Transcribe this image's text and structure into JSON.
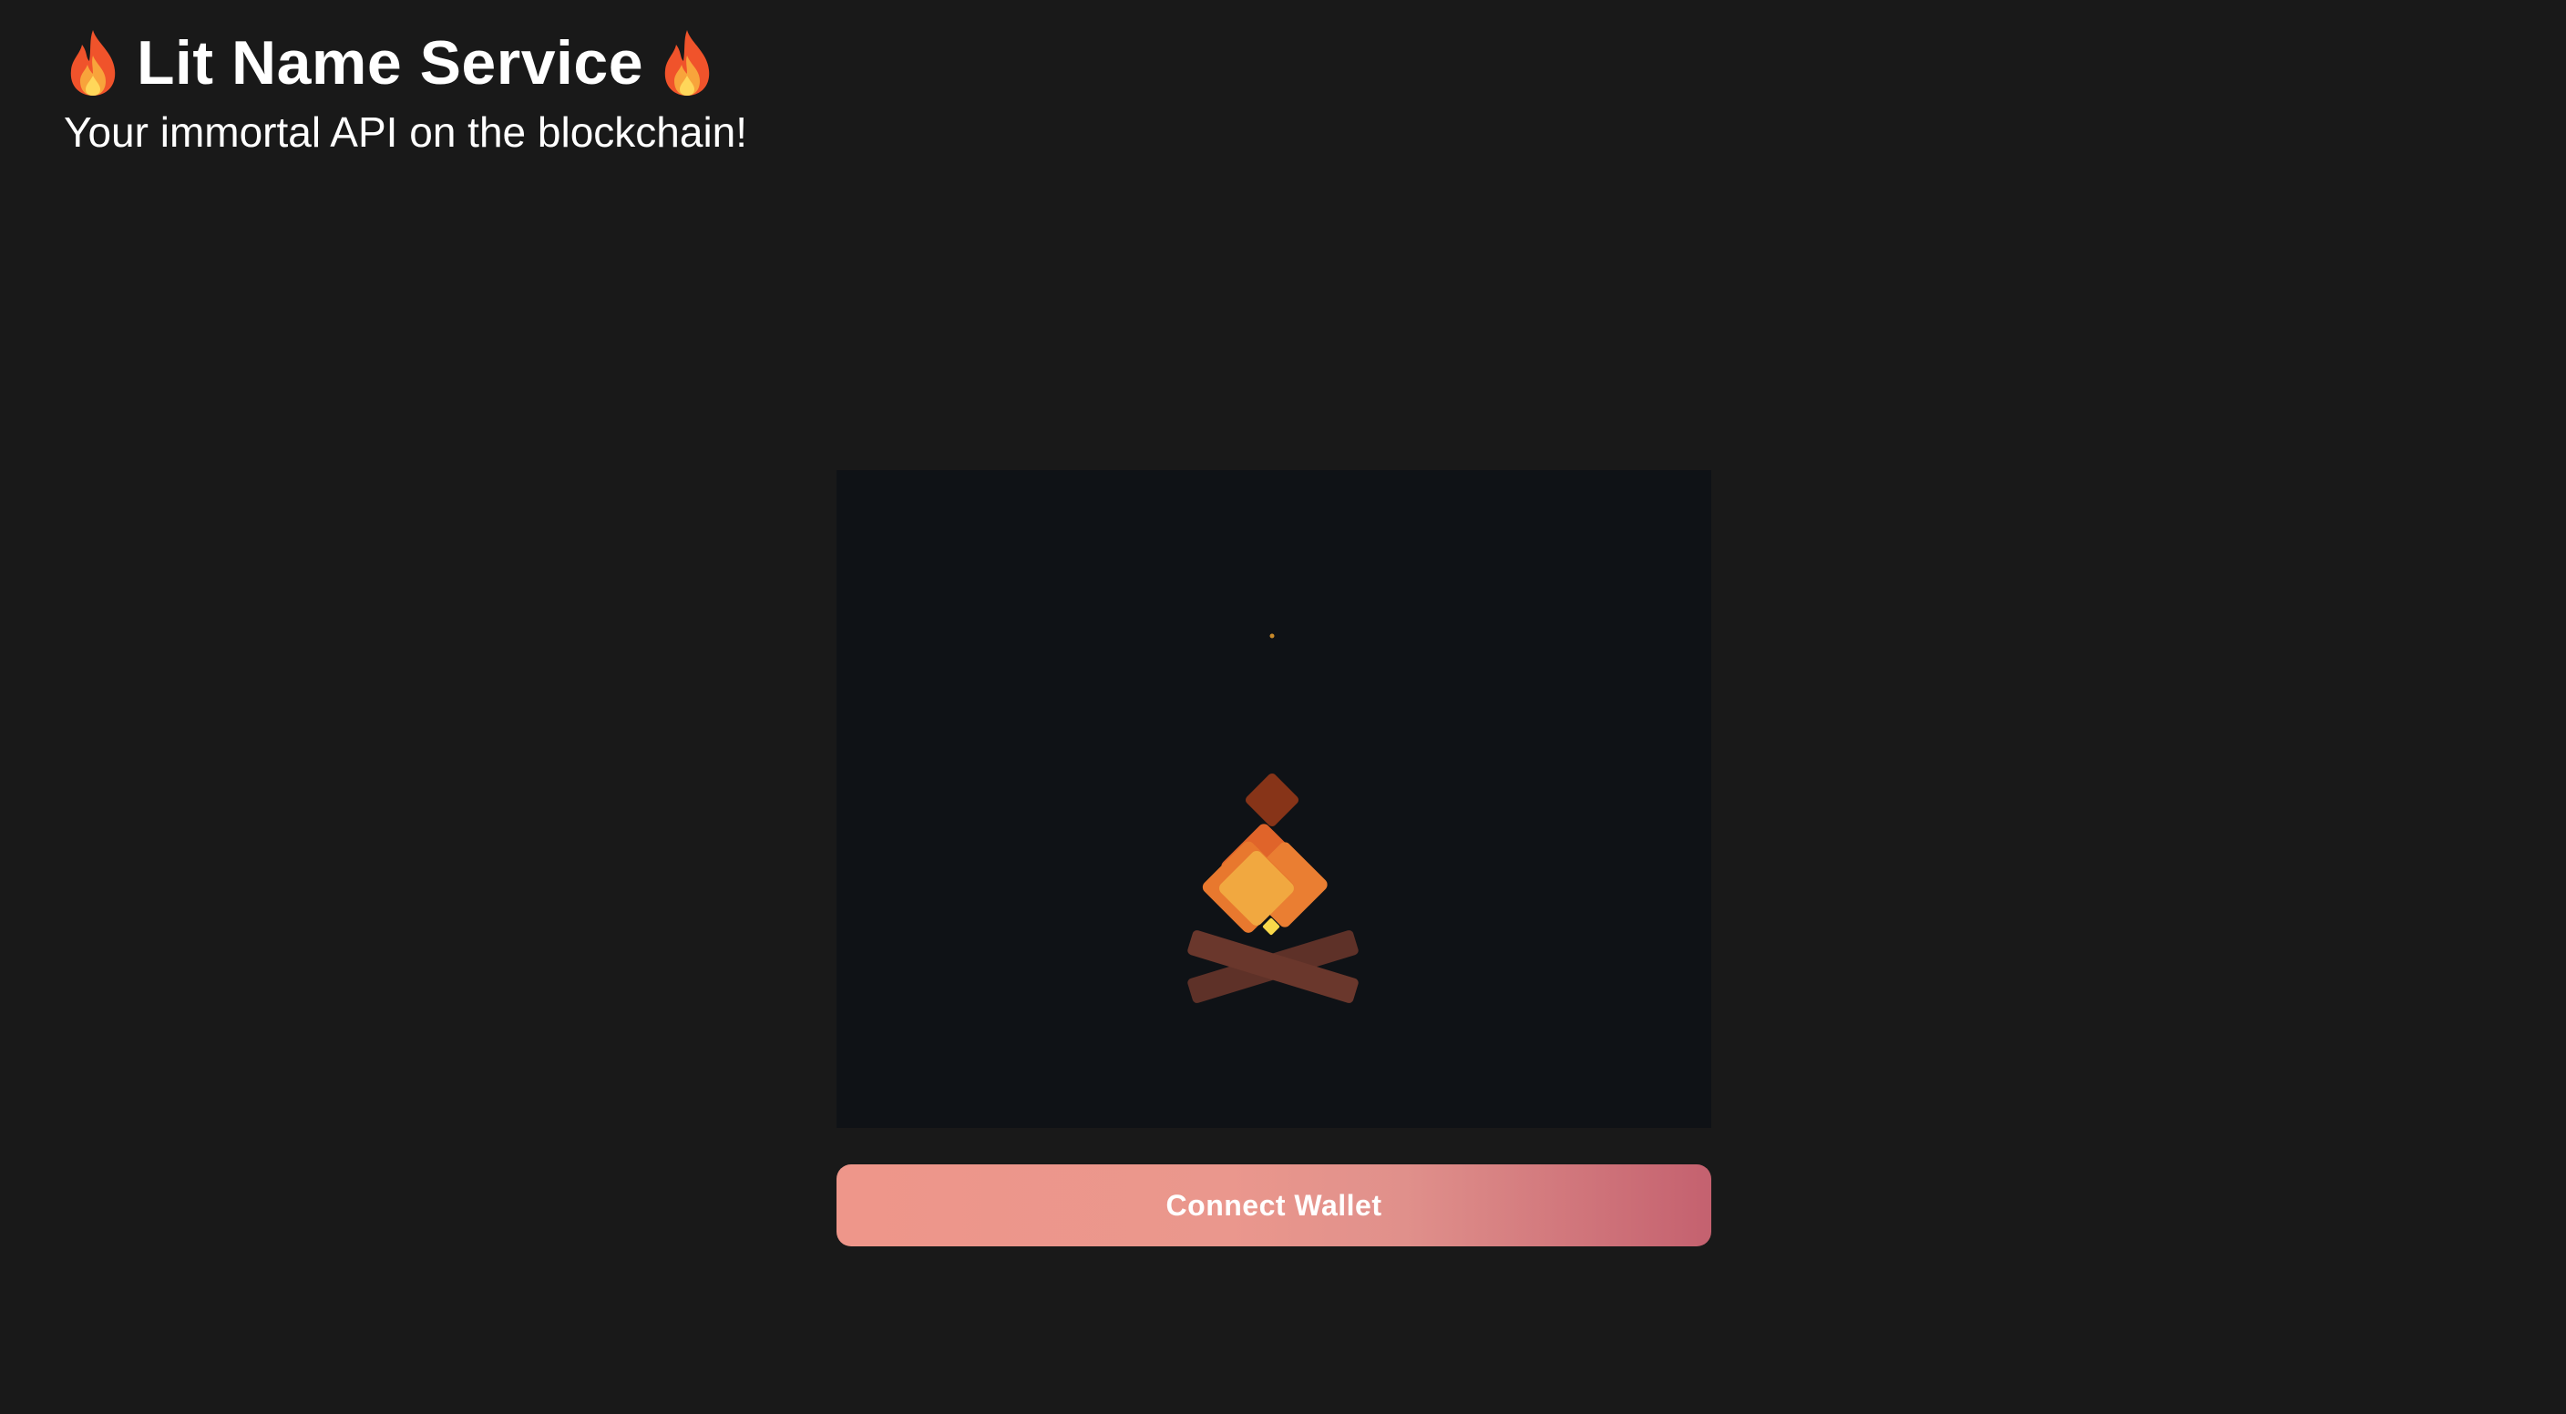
{
  "header": {
    "title": "Lit Name Service",
    "subtitle": "Your immortal API on the blockchain!",
    "left_icon": "fire-icon",
    "right_icon": "fire-icon"
  },
  "main": {
    "illustration": "campfire-animation",
    "connect_button_label": "Connect Wallet"
  },
  "colors": {
    "background": "#191919",
    "scene_background": "#0f1216",
    "button_gradient_start": "#ee968a",
    "button_gradient_end": "#c4616f",
    "flame_orange": "#e8782e",
    "flame_light": "#f1a840",
    "ember": "#873418",
    "log": "#5e3128"
  }
}
